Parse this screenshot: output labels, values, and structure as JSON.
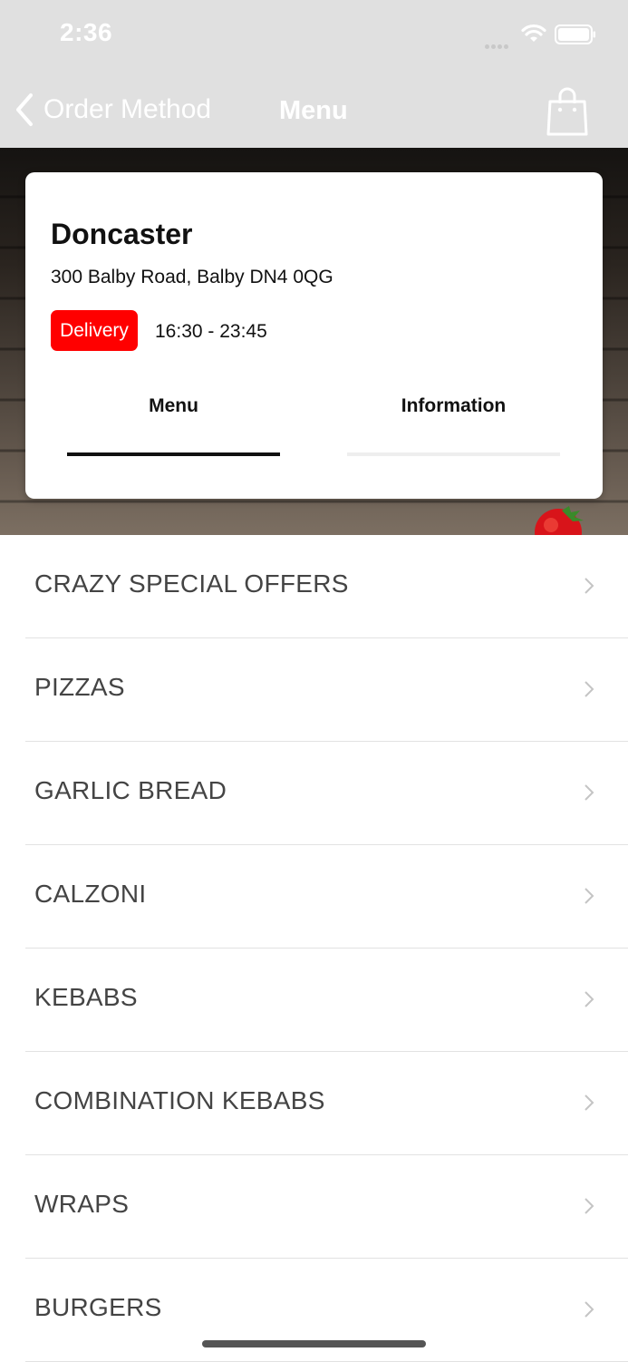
{
  "status_bar": {
    "time": "2:36"
  },
  "nav": {
    "back_label": "Order Method",
    "title": "Menu"
  },
  "store": {
    "name": "Doncaster",
    "address": "300 Balby Road, Balby DN4 0QG",
    "order_type": "Delivery",
    "hours": "16:30 - 23:45",
    "tabs": [
      {
        "label": "Menu",
        "active": true
      },
      {
        "label": "Information",
        "active": false
      }
    ]
  },
  "categories": [
    {
      "label": "CRAZY SPECIAL OFFERS"
    },
    {
      "label": "PIZZAS"
    },
    {
      "label": "GARLIC BREAD"
    },
    {
      "label": "CALZONI"
    },
    {
      "label": "KEBABS"
    },
    {
      "label": "COMBINATION KEBABS"
    },
    {
      "label": "WRAPS"
    },
    {
      "label": "BURGERS"
    }
  ],
  "colors": {
    "accent": "#ff0000",
    "nav_background": "#e0e0e0",
    "text": "#444444"
  },
  "icons": [
    "signal-icon",
    "wifi-icon",
    "battery-icon",
    "back-chevron-icon",
    "shopping-bag-icon",
    "chevron-right-icon"
  ]
}
